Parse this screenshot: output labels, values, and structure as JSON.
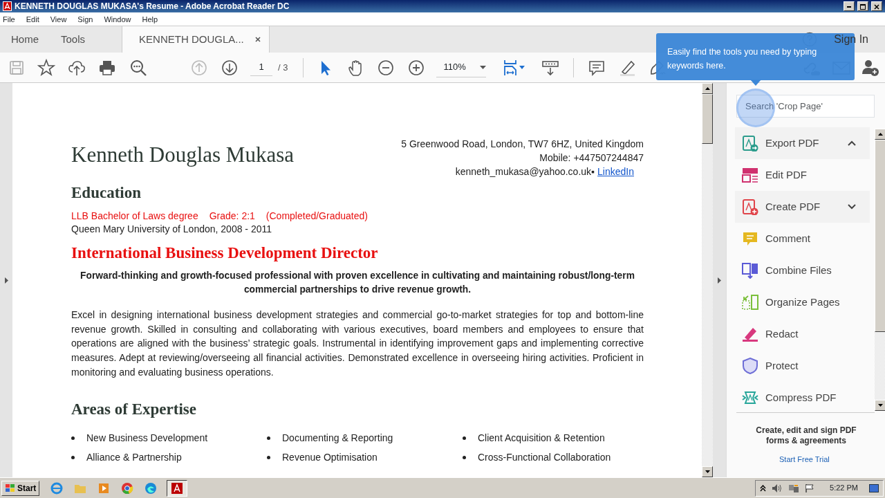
{
  "window": {
    "title": "KENNETH DOUGLAS MUKASA's Resume - Adobe Acrobat Reader DC"
  },
  "menu": [
    "File",
    "Edit",
    "View",
    "Sign",
    "Window",
    "Help"
  ],
  "tabs": [
    {
      "label": "Home",
      "selected": false,
      "closable": false
    },
    {
      "label": "Tools",
      "selected": false,
      "closable": false
    },
    {
      "label": "KENNETH DOUGLA...",
      "selected": true,
      "closable": true
    }
  ],
  "sign_in": "Sign In",
  "toolbar": {
    "page": "1",
    "page_total": "/ 3",
    "zoom": "110%"
  },
  "tooltip": "Easily find the tools you need by typing keywords here.",
  "document": {
    "name": "Kenneth Douglas Mukasa",
    "contact": [
      "5 Greenwood Road, London, TW7 6HZ, United Kingdom",
      "Mobile: +447507244847"
    ],
    "email": "kenneth_mukasa@yahoo.co.uk▪",
    "link": "LinkedIn",
    "education_heading": "Education",
    "degree": [
      "LLB Bachelor of Laws degree",
      "Grade: 2:1",
      "(Completed/Graduated)"
    ],
    "university": "Queen Mary University of London, 2008 - 2011",
    "title": "International Business Development Director",
    "summary": "Forward-thinking and growth-focused professional with proven excellence in cultivating and maintaining robust/long-term commercial partnerships to drive revenue growth.",
    "body": "Excel in designing international business development strategies and commercial go-to-market strategies for top and bottom-line revenue growth. Skilled in consulting and collaborating with various executives, board members and employees to ensure that operations are aligned with the business’ strategic goals. Instrumental in identifying improvement gaps and implementing corrective measures. Adept at reviewing/overseeing all financial activities. Demonstrated excellence in overseeing hiring activities. Proficient in monitoring and evaluating business operations.",
    "expertise_heading": "Areas of Expertise",
    "expertise": [
      "New Business Development",
      "Documenting & Reporting",
      "Client Acquisition & Retention",
      "Alliance & Partnership",
      "Revenue Optimisation",
      "Cross-Functional Collaboration"
    ]
  },
  "tools_pane": {
    "search": {
      "placeholder": "Search 'Crop Page'"
    },
    "items": [
      {
        "label": "Export PDF",
        "color": "#2b9c8c",
        "expanded": true
      },
      {
        "label": "Edit PDF",
        "color": "#d0316f"
      },
      {
        "label": "Create PDF",
        "color": "#e0454b",
        "expanded": false
      },
      {
        "label": "Comment",
        "color": "#e5b820"
      },
      {
        "label": "Combine Files",
        "color": "#5b5bd6"
      },
      {
        "label": "Organize Pages",
        "color": "#7bbf3b"
      },
      {
        "label": "Redact",
        "color": "#d8387e"
      },
      {
        "label": "Protect",
        "color": "#6e6ed6"
      },
      {
        "label": "Compress PDF",
        "color": "#26a69a"
      }
    ],
    "promo": "Create, edit and sign PDF forms & agreements",
    "trial": "Start Free Trial"
  },
  "taskbar": {
    "start": "Start",
    "time": "5:22 PM"
  }
}
